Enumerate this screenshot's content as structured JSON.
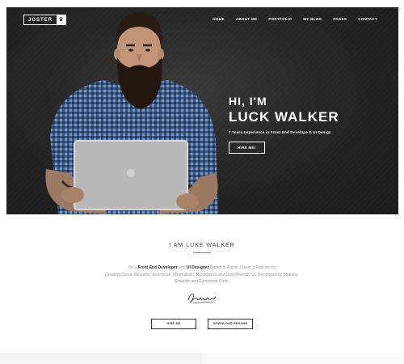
{
  "header": {
    "logo_text": "JOSTER",
    "logo_icon": "emblem-icon",
    "nav": [
      "HOME",
      "ABOUT ME",
      "PORTFOLIO",
      "MY BLOG",
      "PAGES",
      "CONTACT"
    ]
  },
  "hero": {
    "greeting": "HI, I'M",
    "name": "LUCK WALKER",
    "subtitle": "7 Years Experience in Front End Develope & UI Design",
    "cta": "HIRE ME!"
  },
  "about": {
    "title": "I AM LUKE WALKER",
    "intro_prefix": "I'm a ",
    "role1": "Front End Developer",
    "and": " and ",
    "role2": "UI Designer",
    "intro_suffix": " Based in Austin. I have a Passion for",
    "line2": "Creating Clean, Beautiful, Enterprise, Minimalistic, Responsive and User Friendly UI, Developed by Modular,",
    "line3": "Scalable and Functional Code.",
    "signature_text": "Signature",
    "btn_hire": "HIRE ME",
    "btn_resume": "DOWNLOAD RESUME"
  }
}
